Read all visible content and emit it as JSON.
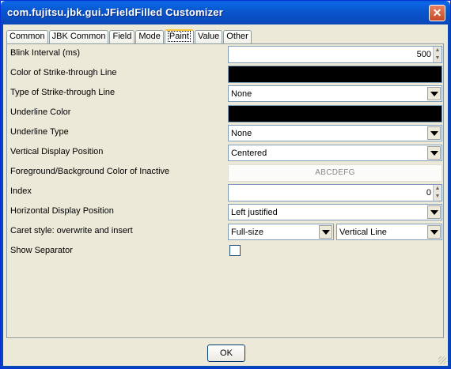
{
  "window": {
    "title": "com.fujitsu.jbk.gui.JFieldFilled Customizer",
    "close_glyph": "✕"
  },
  "tabs": [
    {
      "label": "Common",
      "active": false
    },
    {
      "label": "JBK Common",
      "active": false
    },
    {
      "label": "Field",
      "active": false
    },
    {
      "label": "Mode",
      "active": false
    },
    {
      "label": "Paint",
      "active": true
    },
    {
      "label": "Value",
      "active": false
    },
    {
      "label": "Other",
      "active": false
    }
  ],
  "properties": {
    "blink_interval": {
      "label": "Blink Interval (ms)",
      "value": "500"
    },
    "strike_color": {
      "label": "Color of Strike-through Line",
      "color": "#000000"
    },
    "strike_type": {
      "label": "Type of Strike-through Line",
      "value": "None"
    },
    "underline_color": {
      "label": "Underline Color",
      "color": "#000000"
    },
    "underline_type": {
      "label": "Underline Type",
      "value": "None"
    },
    "vertical_position": {
      "label": "Vertical Display Position",
      "value": "Centered"
    },
    "inactive_color": {
      "label": "Foreground/Background Color of Inactive",
      "preview": "ABCDEFG"
    },
    "index": {
      "label": "Index",
      "value": "0"
    },
    "horizontal_position": {
      "label": "Horizontal Display Position",
      "value": "Left justified"
    },
    "caret_style": {
      "label": "Caret style: overwrite and insert",
      "overwrite": "Full-size",
      "insert": "Vertical Line"
    },
    "show_separator": {
      "label": "Show Separator",
      "checked": false
    }
  },
  "buttons": {
    "ok": "OK"
  },
  "icons": {
    "spin_up": "▲",
    "spin_down": "▼"
  }
}
